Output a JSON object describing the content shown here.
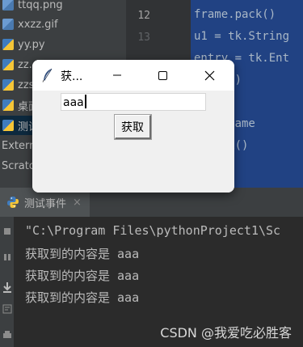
{
  "project_tree": {
    "items": [
      {
        "label": "ttqq.png",
        "icon": "image-file-icon",
        "selected": false
      },
      {
        "label": "xxzz.gif",
        "icon": "image-file-icon",
        "selected": false
      },
      {
        "label": "yy.py",
        "icon": "python-file-icon",
        "selected": false
      },
      {
        "label": "zz.",
        "icon": "python-file-icon",
        "selected": false
      },
      {
        "label": "zzs",
        "icon": "python-file-icon",
        "selected": false
      },
      {
        "label": "桌面",
        "icon": "python-file-icon",
        "selected": false
      },
      {
        "label": "测试",
        "icon": "python-file-icon",
        "selected": true
      },
      {
        "label": "Extern",
        "icon": "folder-icon",
        "selected": false
      },
      {
        "label": "Scrato",
        "icon": "folder-icon",
        "selected": false
      }
    ]
  },
  "editor": {
    "line_numbers": [
      "12",
      "13"
    ],
    "current_line": "12",
    "code_lines": [
      "frame.pack()",
      "u1 = tk.String",
      "entry = tk.Ent",
      ".pack()",
      "",
      "1 = Frame",
      "1.pack()"
    ],
    "selection_color": "#214283"
  },
  "tk_window": {
    "title": "获...",
    "entry_value": "aaa",
    "button_label": "获取",
    "controls": {
      "minimize": "minimize-icon",
      "maximize": "maximize-icon",
      "close": "close-icon"
    }
  },
  "run_panel": {
    "tab_label": "测试事件",
    "tab_close": "×",
    "console_lines": [
      "\"C:\\Program Files\\pythonProject1\\Sc",
      "获取到的内容是 aaa",
      "获取到的内容是 aaa",
      "获取到的内容是 aaa"
    ]
  },
  "watermark": "CSDN @我爱吃必胜客",
  "colors": {
    "ide_bg": "#2b2b2b",
    "panel_bg": "#3c3f41",
    "console_text": "#bbbbbb",
    "tk_bg": "#f0f0f0"
  }
}
